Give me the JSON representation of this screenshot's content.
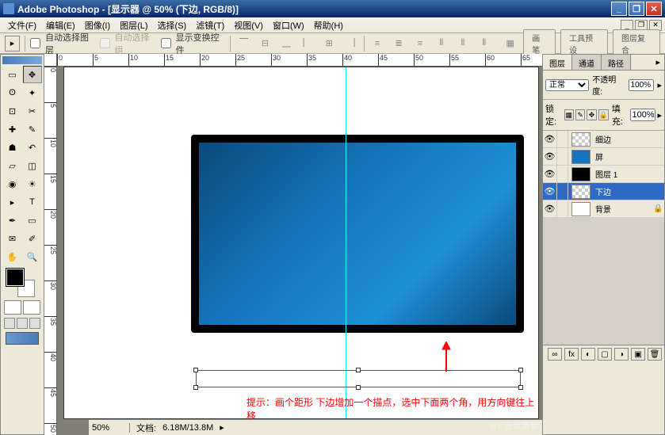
{
  "app": {
    "title": "Adobe Photoshop - [显示器 @ 50% (下边, RGB/8)]"
  },
  "menu": {
    "items": [
      "文件(F)",
      "编辑(E)",
      "图像(I)",
      "图层(L)",
      "选择(S)",
      "滤镜(T)",
      "视图(V)",
      "窗口(W)",
      "帮助(H)"
    ]
  },
  "options": {
    "auto_select_layer": "自动选择图层",
    "auto_select_group": "自动选择组",
    "show_transform": "显示变换控件",
    "wells": [
      "画笔",
      "工具预设",
      "图层复合"
    ]
  },
  "ruler_h": [
    "0",
    "5",
    "10",
    "15",
    "20",
    "25",
    "30",
    "35",
    "40",
    "45",
    "50",
    "55",
    "60",
    "65"
  ],
  "ruler_v": [
    "0",
    "5",
    "10",
    "15",
    "20",
    "25",
    "30",
    "35",
    "40",
    "45",
    "50"
  ],
  "hint": {
    "text": "提示：画个距形 下边增加一个描点，选中下面两个角，用方向键往上移"
  },
  "layers_panel": {
    "tabs": [
      "图层",
      "通道",
      "路径"
    ],
    "blend_mode": "正常",
    "opacity_label": "不透明度:",
    "opacity_value": "100%",
    "lock_label": "锁定:",
    "fill_label": "填充:",
    "fill_value": "100%",
    "layers": [
      {
        "name": "细边",
        "thumb": "checker",
        "visible": true
      },
      {
        "name": "屏",
        "thumb": "blue",
        "visible": true
      },
      {
        "name": "图层 1",
        "thumb": "black",
        "visible": true
      },
      {
        "name": "下边",
        "thumb": "checker",
        "visible": true,
        "selected": true
      },
      {
        "name": "背景",
        "thumb": "white",
        "visible": true,
        "locked": true
      }
    ]
  },
  "status": {
    "zoom": "50%",
    "doc_label": "文档:",
    "doc_value": "6.18M/13.8M"
  },
  "watermark": "BY:吉欧鱼鬃"
}
